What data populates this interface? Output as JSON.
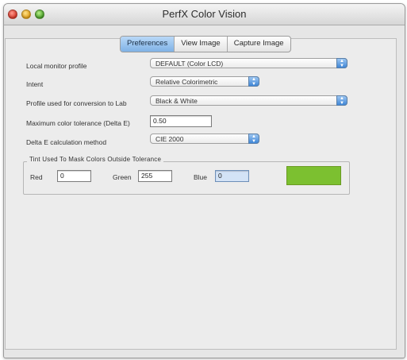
{
  "window": {
    "title": "PerfX Color Vision"
  },
  "tabs": [
    {
      "label": "Preferences",
      "active": true
    },
    {
      "label": "View Image",
      "active": false
    },
    {
      "label": "Capture Image",
      "active": false
    }
  ],
  "preferences": {
    "monitor_profile": {
      "label": "Local monitor profile",
      "value": "DEFAULT (Color LCD)"
    },
    "intent": {
      "label": "Intent",
      "value": "Relative Colorimetric"
    },
    "lab_profile": {
      "label": "Profile used for conversion to Lab",
      "value": "Black & White"
    },
    "tolerance": {
      "label": "Maximum color tolerance (Delta E)",
      "value": "0.50"
    },
    "delta_method": {
      "label": "Delta E calculation method",
      "value": "CIE 2000"
    }
  },
  "tint": {
    "group_title": "Tint Used To Mask Colors Outside Tolerance",
    "red": {
      "label": "Red",
      "value": "0"
    },
    "green": {
      "label": "Green",
      "value": "255"
    },
    "blue": {
      "label": "Blue",
      "value": "0"
    },
    "swatch_color": "#7cc030"
  },
  "colors": {
    "accent": "#7fb2e6",
    "window_bg": "#e6e6e6"
  },
  "icons": {
    "close": "close-button-red",
    "minimize": "minimize-button-yellow",
    "zoom": "zoom-button-green",
    "popup_arrows": "up-down-chevron-icon"
  }
}
